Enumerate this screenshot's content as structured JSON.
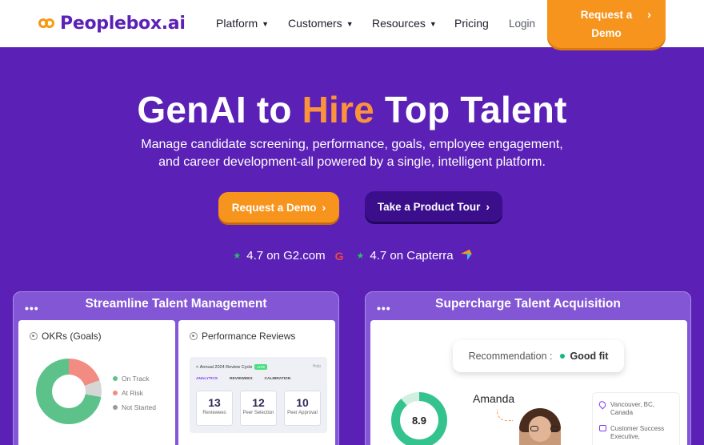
{
  "nav": {
    "logo": "Peoplebox.ai",
    "items": [
      {
        "label": "Platform",
        "has_dropdown": true
      },
      {
        "label": "Customers",
        "has_dropdown": true
      },
      {
        "label": "Resources",
        "has_dropdown": true
      },
      {
        "label": "Pricing",
        "has_dropdown": false
      }
    ],
    "login": "Login",
    "demo_line1": "Request a",
    "demo_line2": "Demo"
  },
  "hero": {
    "title_part1": "GenAI to ",
    "title_highlight": "Hire",
    "title_part2": " Top Talent",
    "subtitle_line1": "Manage candidate screening, performance, goals, employee engagement,",
    "subtitle_line2": "and career development-all powered by a single, intelligent platform.",
    "cta_primary": "Request a Demo",
    "cta_secondary": "Take a Product Tour"
  },
  "ratings": [
    {
      "text": "4.7 on G2.com",
      "badge": "G"
    },
    {
      "text": "4.7 on Capterra",
      "badge": ""
    }
  ],
  "cards": {
    "left": {
      "title": "Streamline Talent Management",
      "okr": {
        "title": "OKRs (Goals)",
        "legend": [
          {
            "label": "On Track",
            "color": "#5cc28a"
          },
          {
            "label": "At Risk",
            "color": "#f28b82"
          },
          {
            "label": "Not Started",
            "color": "#9a9a9a"
          }
        ]
      },
      "perf": {
        "title": "Performance Reviews",
        "cycle": "Annual 2024 Review Cycle",
        "live": "LIVE",
        "help": "Help",
        "tabs": [
          "ANALYTICS",
          "REVIEWEES",
          "CALIBRATION"
        ],
        "stats": [
          {
            "value": "13",
            "label": "Reviewees"
          },
          {
            "value": "12",
            "label": "Peer Selection"
          },
          {
            "value": "10",
            "label": "Peer Approval"
          }
        ]
      }
    },
    "right": {
      "title": "Supercharge Talent Acquisition",
      "reco_label": "Recommendation :",
      "reco_value": "Good fit",
      "score": "8.9",
      "candidate": "Amanda",
      "location": "Vancouver, BC, Canada",
      "role": "Customer Success Executive,"
    }
  },
  "colors": {
    "brand_purple": "#5b21b6",
    "accent_orange": "#f7941d",
    "dark_purple": "#3b0f8c"
  }
}
